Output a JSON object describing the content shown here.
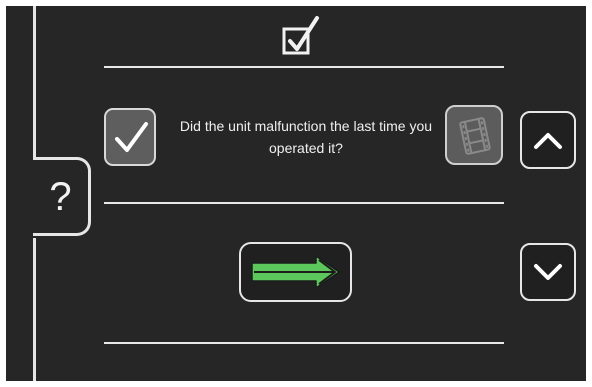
{
  "question": {
    "text": "Did the unit malfunction the last time you operated it?"
  },
  "help": {
    "label": "?"
  },
  "icons": {
    "header": "checkbox-checked-icon",
    "answer": "checkmark-icon",
    "video": "film-icon",
    "up": "chevron-up-icon",
    "down": "chevron-down-icon",
    "next": "arrow-right-icon"
  },
  "colors": {
    "background": "#262626",
    "line": "#e6e6e6",
    "next_arrow": "#5cc85c"
  }
}
